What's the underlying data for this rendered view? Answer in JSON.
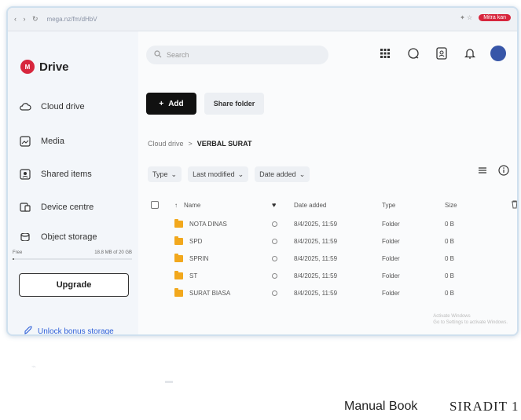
{
  "browser": {
    "url": "mega.nz/fm/dHbV",
    "profile_label": "Mitra kan"
  },
  "app": {
    "name": "Drive",
    "logo_text": "M"
  },
  "sidebar": {
    "items": [
      {
        "label": "Cloud drive",
        "icon": "cloud-icon"
      },
      {
        "label": "Media",
        "icon": "image-icon"
      },
      {
        "label": "Shared items",
        "icon": "shared-folder-icon"
      },
      {
        "label": "Device centre",
        "icon": "devices-icon"
      },
      {
        "label": "Object storage",
        "icon": "storage-icon"
      }
    ],
    "storage": {
      "plan": "Free",
      "used": "18.8 MB of 20 GB",
      "fraction": 0.001
    },
    "upgrade_label": "Upgrade",
    "unlock_label": "Unlock bonus storage"
  },
  "search": {
    "placeholder": "Search"
  },
  "toolbar": {
    "add_label": "Add",
    "share_label": "Share folder"
  },
  "breadcrumb": {
    "root": "Cloud drive",
    "separator": ">",
    "current": "VERBAL SURAT"
  },
  "filters": [
    {
      "label": "Type"
    },
    {
      "label": "Last modified"
    },
    {
      "label": "Date added"
    }
  ],
  "table": {
    "headers": {
      "name": "Name",
      "date": "Date added",
      "type": "Type",
      "size": "Size"
    },
    "rows": [
      {
        "name": "NOTA DINAS",
        "date": "8/4/2025, 11:59",
        "type": "Folder",
        "size": "0 B"
      },
      {
        "name": "SPD",
        "date": "8/4/2025, 11:59",
        "type": "Folder",
        "size": "0 B"
      },
      {
        "name": "SPRIN",
        "date": "8/4/2025, 11:59",
        "type": "Folder",
        "size": "0 B"
      },
      {
        "name": "ST",
        "date": "8/4/2025, 11:59",
        "type": "Folder",
        "size": "0 B"
      },
      {
        "name": "SURAT BIASA",
        "date": "8/4/2025, 11:59",
        "type": "Folder",
        "size": "0 B"
      }
    ]
  },
  "watermark": {
    "line1": "Activate Windows",
    "line2": "Go to Settings to activate Windows."
  },
  "footer": {
    "title": "Manual Book",
    "logo": "SIRADIT 1"
  },
  "colors": {
    "accent": "#d7263d",
    "folder": "#f2a81d",
    "link": "#2d5fd8"
  }
}
